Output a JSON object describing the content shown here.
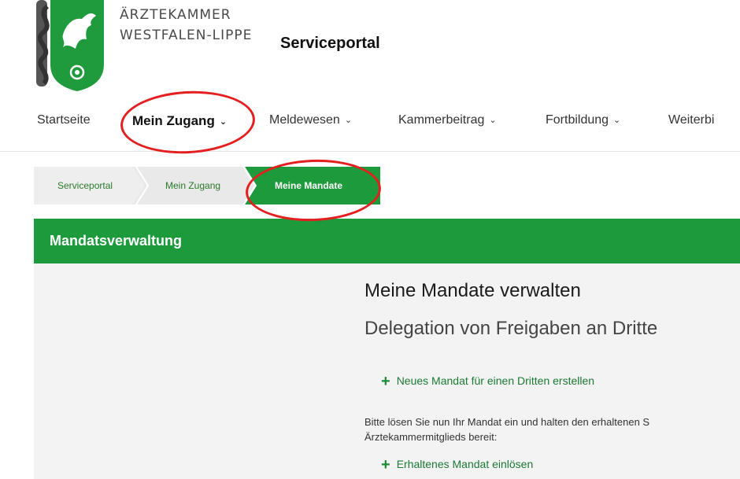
{
  "header": {
    "org_line1": "ÄRZTEKAMMER",
    "org_line2": "WESTFALEN-LIPPE",
    "portal_title": "Serviceportal"
  },
  "nav": {
    "items": [
      {
        "label": "Startseite",
        "dropdown": false
      },
      {
        "label": "Mein Zugang",
        "dropdown": true,
        "active": true
      },
      {
        "label": "Meldewesen",
        "dropdown": true
      },
      {
        "label": "Kammerbeitrag",
        "dropdown": true
      },
      {
        "label": "Fortbildung",
        "dropdown": true
      },
      {
        "label": "Weiterbi",
        "dropdown": false
      }
    ],
    "chevron": "⌄"
  },
  "breadcrumb": {
    "items": [
      "Serviceportal",
      "Mein Zugang",
      "Meine Mandate"
    ]
  },
  "panel": {
    "title": "Mandatsverwaltung",
    "heading": "Meine Mandate verwalten",
    "subheading": "Delegation von Freigaben an Dritte",
    "action_new": "Neues Mandat für einen Dritten erstellen",
    "info_line1": "Bitte lösen Sie nun Ihr Mandat ein und halten den erhaltenen S",
    "info_line2": "Ärztekammermitglieds bereit:",
    "action_redeem": "Erhaltenes Mandat einlösen",
    "plus_symbol": "+"
  },
  "colors": {
    "brand_green": "#1d9a3c",
    "annotation_red": "#e41f1f"
  }
}
